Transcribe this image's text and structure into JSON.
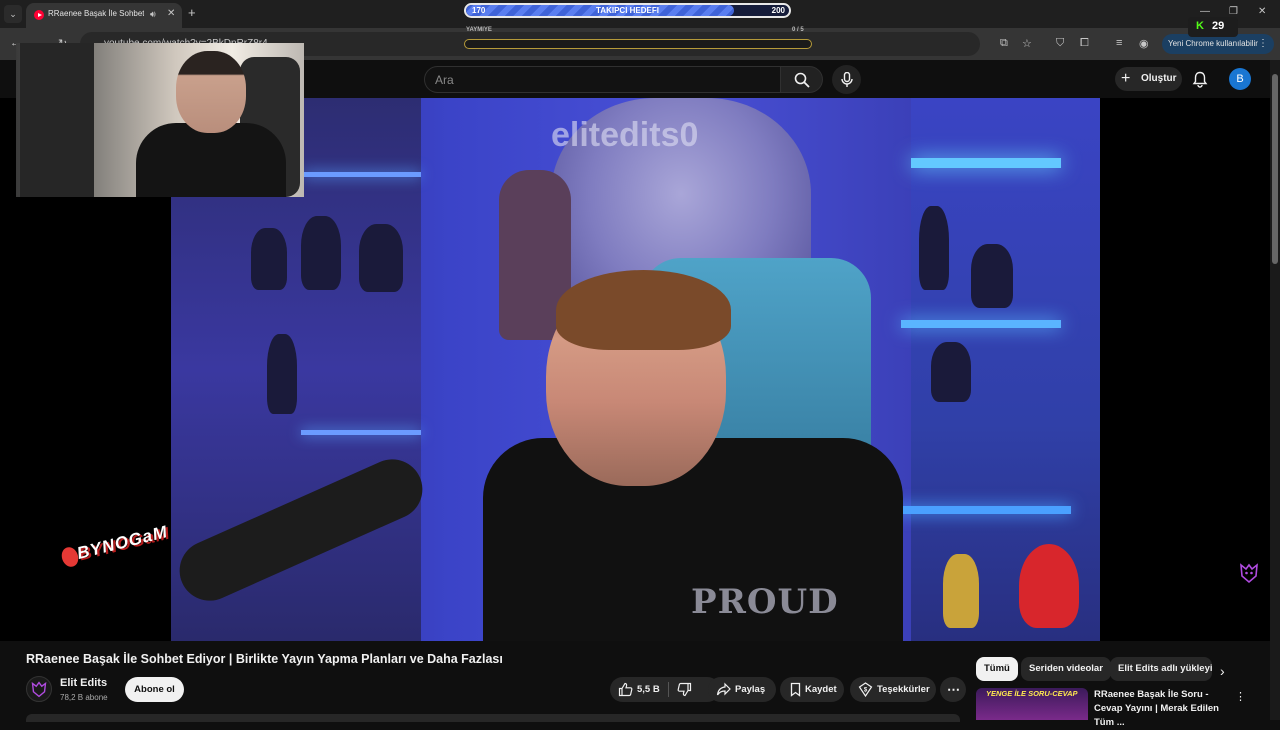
{
  "browser": {
    "tab_title": "RRaenee Başak İle Sohbet E",
    "url": "youtube.com/watch?v=2BkDnRrZ8r4",
    "update_label": "Yeni Chrome kullanılabilir"
  },
  "overlay": {
    "goal_min": "170",
    "goal_label": "TAKIPCI HEDEFI",
    "goal_max": "200",
    "goal_progress": 0.83,
    "goal2_left": "YAYMIYE",
    "goal2_right": "0 / 5",
    "kick_count": "29",
    "watermark": "elitedits0",
    "sponsor": "BYNOGaM"
  },
  "youtube": {
    "search_placeholder": "Ara",
    "create_label": "Oluştur",
    "account_initial": "B"
  },
  "video": {
    "title": "RRaenee Başak İle Sohbet Ediyor | Birlikte Yayın Yapma Planları ve Daha Fazlası",
    "channel_name": "Elit Edits",
    "subscribers": "78,2 B abone",
    "subscribe_label": "Abone ol",
    "likes": "5,5 B",
    "share_label": "Paylaş",
    "save_label": "Kaydet",
    "thanks_label": "Teşekkürler"
  },
  "sidebar": {
    "chips": [
      "Tümü",
      "Seriden videolar",
      "Elit Edits adlı yükleyici"
    ],
    "related": {
      "thumb_text": "YENGE İLE SORU-CEVAP",
      "title": "RRaenee Başak İle Soru - Cevap Yayını | Merak Edilen Tüm ..."
    }
  },
  "colors": {
    "accent": "#ff0033",
    "goal_fill": "#3f63d8",
    "kick_green": "#53fc18",
    "update_bg": "#1b3f62"
  }
}
